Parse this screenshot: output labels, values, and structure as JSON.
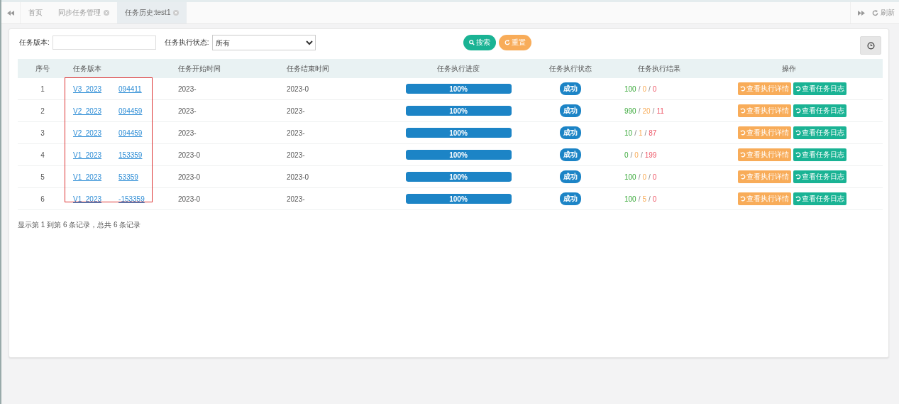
{
  "tabs": [
    {
      "label": "首页",
      "closable": false,
      "selected": false
    },
    {
      "label": "同步任务管理",
      "closable": true,
      "selected": false
    },
    {
      "label": "任务历史:test1",
      "closable": true,
      "selected": true
    }
  ],
  "refresh": "刷新",
  "filters": [
    {
      "label": "任务版本:",
      "kind": "text"
    },
    {
      "label": "任务执行状态:",
      "kind": "select",
      "value": "所有"
    }
  ],
  "search_button": "搜索",
  "reset_button": "重置",
  "table": {
    "columns": [
      "序号",
      "任务版本",
      "任务开始时间",
      "任务结束时间",
      "任务执行进度",
      "任务执行状态",
      "任务执行结果",
      "操作"
    ],
    "rows": [
      {
        "index": "1",
        "version_start": "V3_2023",
        "version_end": "094411",
        "start_time": "2023-",
        "end_time": "2023-0",
        "progress": "100%",
        "level": 1,
        "status": "成功",
        "result": [
          "100",
          "0",
          "0"
        ],
        "actions": [
          "查看执行详情",
          "查看任务日志"
        ]
      },
      {
        "index": "2",
        "version_start": "V2_2023",
        "version_end": "094459",
        "start_time": "2023-",
        "end_time": "2023-",
        "progress": "100%",
        "level": 1,
        "status": "成功",
        "result": [
          "990",
          "20",
          "11"
        ],
        "actions": [
          "查看执行详情",
          "查看任务日志"
        ]
      },
      {
        "index": "3",
        "version_start": "V2_2023",
        "version_end": "094459",
        "start_time": "2023-",
        "end_time": "2023-",
        "progress": "100%",
        "level": 1,
        "status": "成功",
        "result": [
          "10",
          "1",
          "87"
        ],
        "actions": [
          "查看执行详情",
          "查看任务日志"
        ]
      },
      {
        "index": "4",
        "version_start": "V1_2023",
        "version_end": "153359",
        "start_time": "2023-0",
        "end_time": "2023-",
        "progress": "100%",
        "level": 1,
        "status": "成功",
        "result": [
          "0",
          "0",
          "199"
        ],
        "actions": [
          "查看执行详情",
          "查看任务日志"
        ]
      },
      {
        "index": "5",
        "version_start": "V1_2023",
        "version_end": "53359",
        "start_time": "2023-0",
        "end_time": "2023-0",
        "progress": "100%",
        "level": 1,
        "status": "成功",
        "result": [
          "100",
          "0",
          "0"
        ],
        "actions": [
          "查看执行详情",
          "查看任务日志"
        ]
      },
      {
        "index": "6",
        "version_start": "V1_2023",
        "version_end": "-153359",
        "start_time": "2023-0",
        "end_time": "2023-",
        "progress": "100%",
        "level": 1,
        "status": "成功",
        "result": [
          "100",
          "5",
          "0"
        ],
        "actions": [
          "查看执行详情",
          "查看任务日志"
        ]
      }
    ]
  },
  "result_separator": "/",
  "pagination": "显示第 1 到第 6 条记录，总共 6 条记录"
}
